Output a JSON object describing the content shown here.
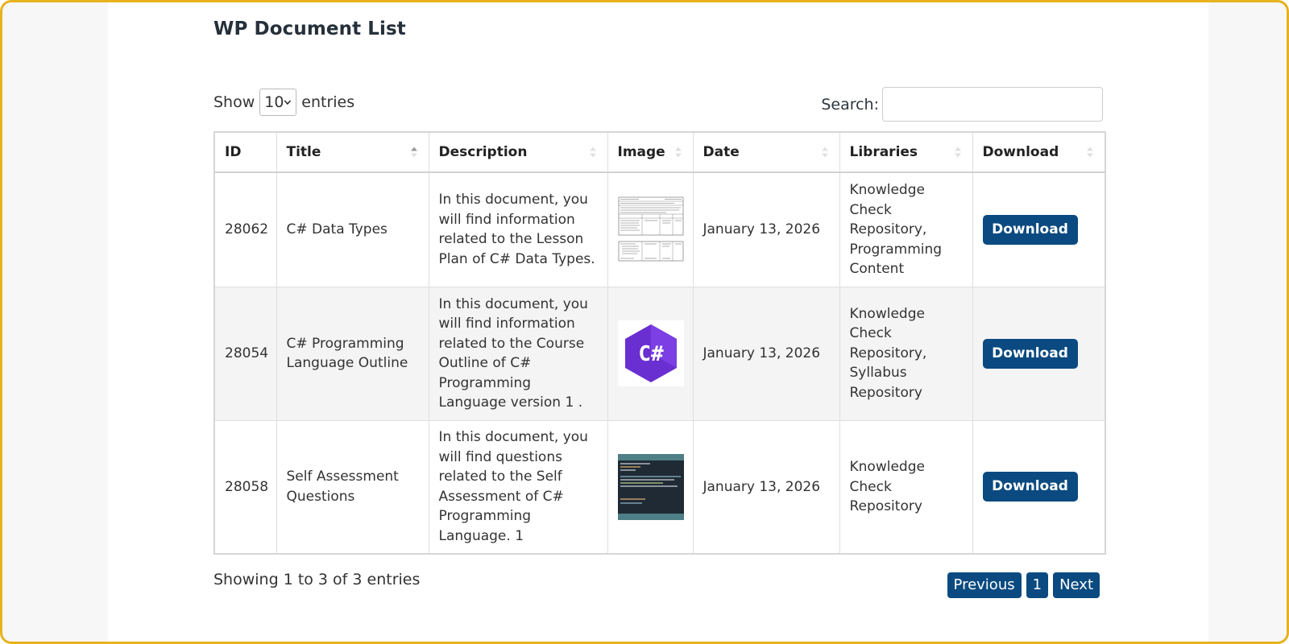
{
  "page": {
    "title": "WP Document List"
  },
  "length_control": {
    "prefix": "Show",
    "value": "10",
    "suffix": "entries"
  },
  "search": {
    "label": "Search:",
    "value": "",
    "placeholder": ""
  },
  "table": {
    "columns": [
      "ID",
      "Title",
      "Description",
      "Image",
      "Date",
      "Libraries",
      "Download"
    ],
    "sorted_column": "Title",
    "rows": [
      {
        "id": "28062",
        "title": "C# Data Types",
        "description": "In this document, you will find information related to the Lesson Plan of C# Data Types.",
        "image": "lesson-plan-document-thumbnail",
        "date": "January 13, 2026",
        "libraries": "Knowledge Check Repository, Programming Content",
        "download_label": "Download"
      },
      {
        "id": "28054",
        "title": "C# Programming Language Outline",
        "description": "In this document, you will find information related to the Course Outline of C# Programming Language version 1 .",
        "image": "csharp-logo",
        "image_text": "C#",
        "date": "January 13, 2026",
        "libraries": "Knowledge Check Repository, Syllabus Repository",
        "download_label": "Download"
      },
      {
        "id": "28058",
        "title": "Self Assessment Questions",
        "description": "In this document, you will find questions related to the Self Assessment of C# Programming Language. 1",
        "image": "code-editor-screenshot",
        "date": "January 13, 2026",
        "libraries": "Knowledge Check Repository",
        "download_label": "Download"
      }
    ]
  },
  "footer": {
    "info": "Showing 1 to 3 of 3 entries",
    "previous": "Previous",
    "page": "1",
    "next": "Next"
  },
  "colors": {
    "accent": "#0a4a80",
    "frame": "#e8b21e",
    "csharp_purple": "#6a2fd0"
  }
}
